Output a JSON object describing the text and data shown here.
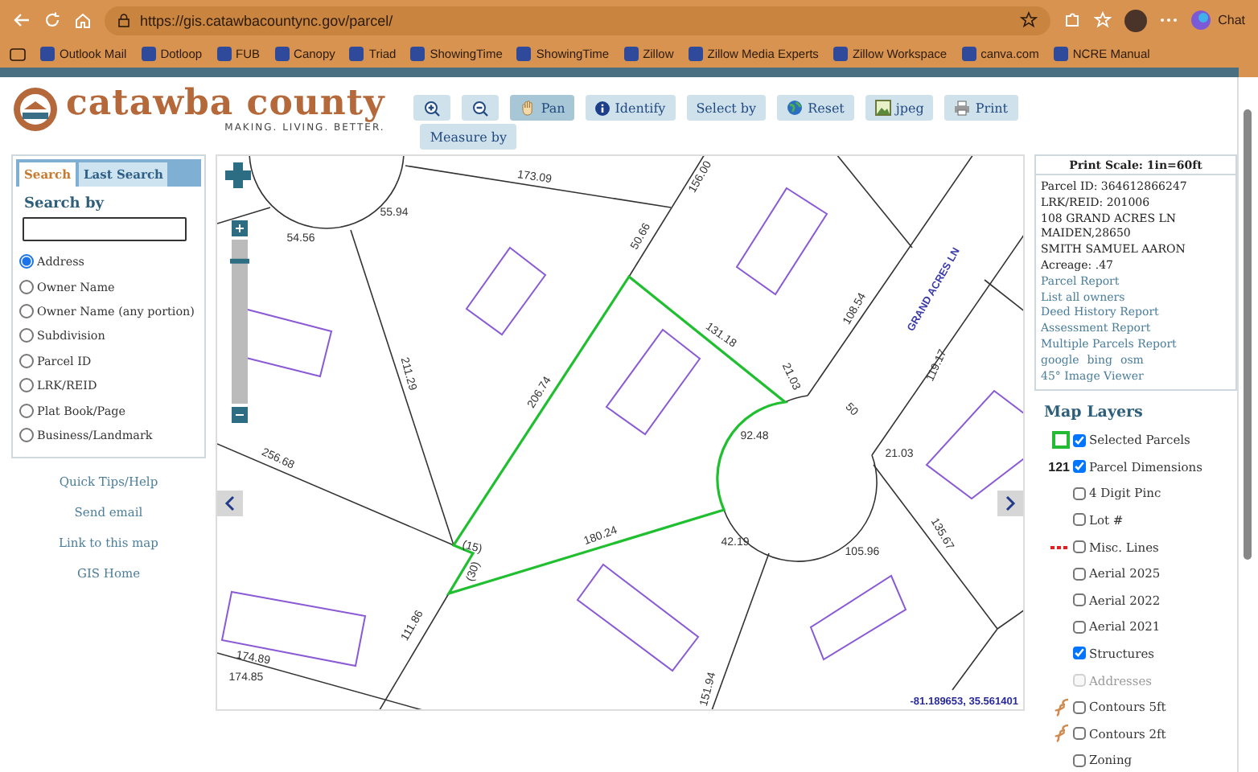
{
  "browser": {
    "url": "https://gis.catawbacountync.gov/parcel/",
    "chat_label": "Chat",
    "bookmarks": [
      "Outlook Mail",
      "Dotloop",
      "FUB",
      "Canopy",
      "Triad",
      "ShowingTime",
      "ShowingTime",
      "Zillow",
      "Zillow Media Experts",
      "Zillow Workspace",
      "canva.com",
      "NCRE Manual"
    ]
  },
  "header": {
    "logo_name": "catawba county",
    "logo_tagline": "MAKING. LIVING. BETTER."
  },
  "toolbar_rows": [
    [
      {
        "selected": false
      },
      {
        "selected": false
      },
      {
        "label": "Pan",
        "selected": true
      },
      {
        "label": "Identify",
        "selected": false
      },
      {
        "label": "Select by",
        "selected": false
      },
      {
        "label": "Reset",
        "selected": false
      },
      {
        "label": "jpeg",
        "selected": false
      },
      {
        "label": "Print",
        "selected": false
      }
    ],
    [
      {
        "label": "Measure by",
        "selected": false
      }
    ]
  ],
  "search_panel": {
    "tabs": [
      {
        "label": "Search",
        "selected": true
      },
      {
        "label": "Last Search",
        "selected": false
      }
    ],
    "heading": "Search by",
    "options": [
      {
        "label": "Address",
        "selected": true
      },
      {
        "label": "Owner Name",
        "selected": false
      },
      {
        "label": "Owner Name (any portion)",
        "selected": false
      },
      {
        "label": "Subdivision",
        "selected": false
      },
      {
        "label": "Parcel ID",
        "selected": false
      },
      {
        "label": "LRK/REID",
        "selected": false
      },
      {
        "label": "Plat Book/Page",
        "selected": false
      },
      {
        "label": "Business/Landmark",
        "selected": false
      }
    ]
  },
  "side_links": [
    "Quick Tips/Help",
    "Send email",
    "Link to this map",
    "GIS Home"
  ],
  "map": {
    "dimension_labels": [
      "173.09",
      "55.94",
      "54.56",
      "156.00",
      "50.66",
      "211.29",
      "206.74",
      "131.18",
      "21.03",
      "108.54",
      "119.17",
      "50",
      "92.48",
      "21.03",
      "256.68",
      "180.24",
      "(15)",
      "(30)",
      "42.19",
      "105.96",
      "135.67",
      "111.86",
      "174.89",
      "174.85",
      "151.94"
    ],
    "street_label": "GRAND ACRES LN",
    "zoom_slider": {
      "level": 0.88
    },
    "coordinates": "-81.189653, 35.561401"
  },
  "parcel_info": {
    "print_scale": "Print Scale: 1in=60ft",
    "details": [
      "Parcel ID: 364612866247",
      "LRK/REID: 201006",
      "108 GRAND ACRES LN",
      "MAIDEN,28650",
      "SMITH SAMUEL AARON",
      "Acreage: .47"
    ],
    "link_rows": [
      [
        "Parcel Report"
      ],
      [
        "List all owners"
      ],
      [
        "Deed History Report"
      ],
      [
        "Assessment Report"
      ],
      [
        "Multiple Parcels Report"
      ],
      [
        "google",
        "bing",
        "osm"
      ],
      [
        "45° Image Viewer"
      ]
    ]
  },
  "map_layers": {
    "title": "Map Layers",
    "layers": [
      {
        "label": "Selected Parcels",
        "checked": true,
        "disabled": false,
        "kind": "swatch"
      },
      {
        "label": "Parcel Dimensions",
        "checked": true,
        "disabled": false,
        "kind": "count",
        "legend_text": "121"
      },
      {
        "label": "4 Digit Pinc",
        "checked": false,
        "disabled": false,
        "kind": "plain"
      },
      {
        "label": "Lot #",
        "checked": false,
        "disabled": false,
        "kind": "plain"
      },
      {
        "label": "Misc. Lines",
        "checked": false,
        "disabled": false,
        "kind": "dashes"
      },
      {
        "label": "Aerial 2025",
        "checked": false,
        "disabled": false,
        "kind": "plain"
      },
      {
        "label": "Aerial 2022",
        "checked": false,
        "disabled": false,
        "kind": "plain"
      },
      {
        "label": "Aerial 2021",
        "checked": false,
        "disabled": false,
        "kind": "plain"
      },
      {
        "label": "Structures",
        "checked": true,
        "disabled": false,
        "kind": "plain"
      },
      {
        "label": "Addresses",
        "checked": false,
        "disabled": true,
        "kind": "plain"
      },
      {
        "label": "Contours 5ft",
        "checked": false,
        "disabled": false,
        "kind": "contour"
      },
      {
        "label": "Contours 2ft",
        "checked": false,
        "disabled": false,
        "kind": "contour"
      },
      {
        "label": "Zoning",
        "checked": false,
        "disabled": false,
        "kind": "plain"
      }
    ]
  }
}
